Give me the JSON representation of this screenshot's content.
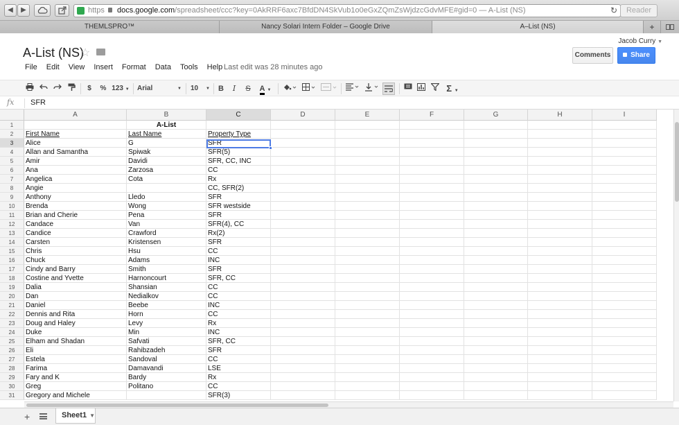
{
  "browser": {
    "back": "◀",
    "forward": "▶",
    "scheme": "https",
    "host": "docs.google.com",
    "path": "/spreadsheet/ccc?key=0AkRRF6axc7BfdDN4SkVub1o0eGxZQmZsWjdzcGdvMFE#gid=0",
    "page_title": "A-List (NS)",
    "reader": "Reader",
    "reload": "↻"
  },
  "tabs": [
    {
      "label": "THEMLSPRO™"
    },
    {
      "label": "Nancy Solari Intern Folder – Google Drive"
    },
    {
      "label": "A–List (NS)"
    }
  ],
  "tab_add": "+",
  "doc": {
    "title": "A-List (NS)",
    "user": "Jacob Curry",
    "comments": "Comments",
    "share": "Share",
    "last_edit": "Last edit was 28 minutes ago"
  },
  "menus": [
    "File",
    "Edit",
    "View",
    "Insert",
    "Format",
    "Data",
    "Tools",
    "Help"
  ],
  "toolbar": {
    "currency": "$",
    "percent": "%",
    "number_format": "123",
    "font": "Arial",
    "size": "10",
    "bold": "B",
    "italic": "I",
    "strike": "S",
    "text_color": "A",
    "sum": "Σ"
  },
  "formula": {
    "fx": "fx",
    "value": "SFR"
  },
  "columns": [
    "A",
    "B",
    "C",
    "D",
    "E",
    "F",
    "G",
    "H",
    "I"
  ],
  "selected_column": "C",
  "selected_row": 3,
  "rows": [
    [
      "",
      "A-List",
      ""
    ],
    [
      "First Name",
      "Last Name",
      "Property Type"
    ],
    [
      "Alice",
      "G",
      "SFR"
    ],
    [
      "Allan and Samantha",
      "Spiwak",
      "SFR(5)"
    ],
    [
      "Amir",
      "Davidi",
      "SFR, CC, INC"
    ],
    [
      "Ana",
      "Zarzosa",
      "CC"
    ],
    [
      "Angelica",
      "Cota",
      "Rx"
    ],
    [
      "Angie",
      "",
      "CC, SFR(2)"
    ],
    [
      "Anthony",
      "Lledo",
      "SFR"
    ],
    [
      "Brenda",
      "Wong",
      "SFR westside"
    ],
    [
      "Brian and Cherie",
      "Pena",
      "SFR"
    ],
    [
      "Candace",
      "Van",
      "SFR(4), CC"
    ],
    [
      "Candice",
      "Crawford",
      "Rx(2)"
    ],
    [
      "Carsten",
      "Kristensen",
      "SFR"
    ],
    [
      "Chris",
      "Hsu",
      "CC"
    ],
    [
      "Chuck",
      "Adams",
      "INC"
    ],
    [
      "Cindy and Barry",
      "Smith",
      "SFR"
    ],
    [
      "Costine and Yvette",
      "Harnoncourt",
      "SFR, CC"
    ],
    [
      "Dalia",
      "Shansian",
      "CC"
    ],
    [
      "Dan",
      "Nedialkov",
      "CC"
    ],
    [
      "Daniel",
      "Beebe",
      "INC"
    ],
    [
      "Dennis and Rita",
      "Horn",
      "CC"
    ],
    [
      "Doug and Haley",
      "Levy",
      "Rx"
    ],
    [
      "Duke",
      "Min",
      "INC"
    ],
    [
      "Elham and Shadan",
      "Safvati",
      "SFR, CC"
    ],
    [
      "Eli",
      "Rahibzadeh",
      "SFR"
    ],
    [
      "Estela",
      "Sandoval",
      "CC"
    ],
    [
      "Farima",
      "Damavandi",
      "LSE"
    ],
    [
      "Fary and K",
      "Bardy",
      "Rx"
    ],
    [
      "Greg",
      "Politano",
      "CC"
    ],
    [
      "Gregory and Michele",
      "",
      "SFR(3)"
    ]
  ],
  "sheet": {
    "add": "+",
    "name": "Sheet1",
    "menu_arrow": "▼"
  },
  "colors": {
    "share_blue": "#4d90fe",
    "selection": "#4d7be5"
  }
}
